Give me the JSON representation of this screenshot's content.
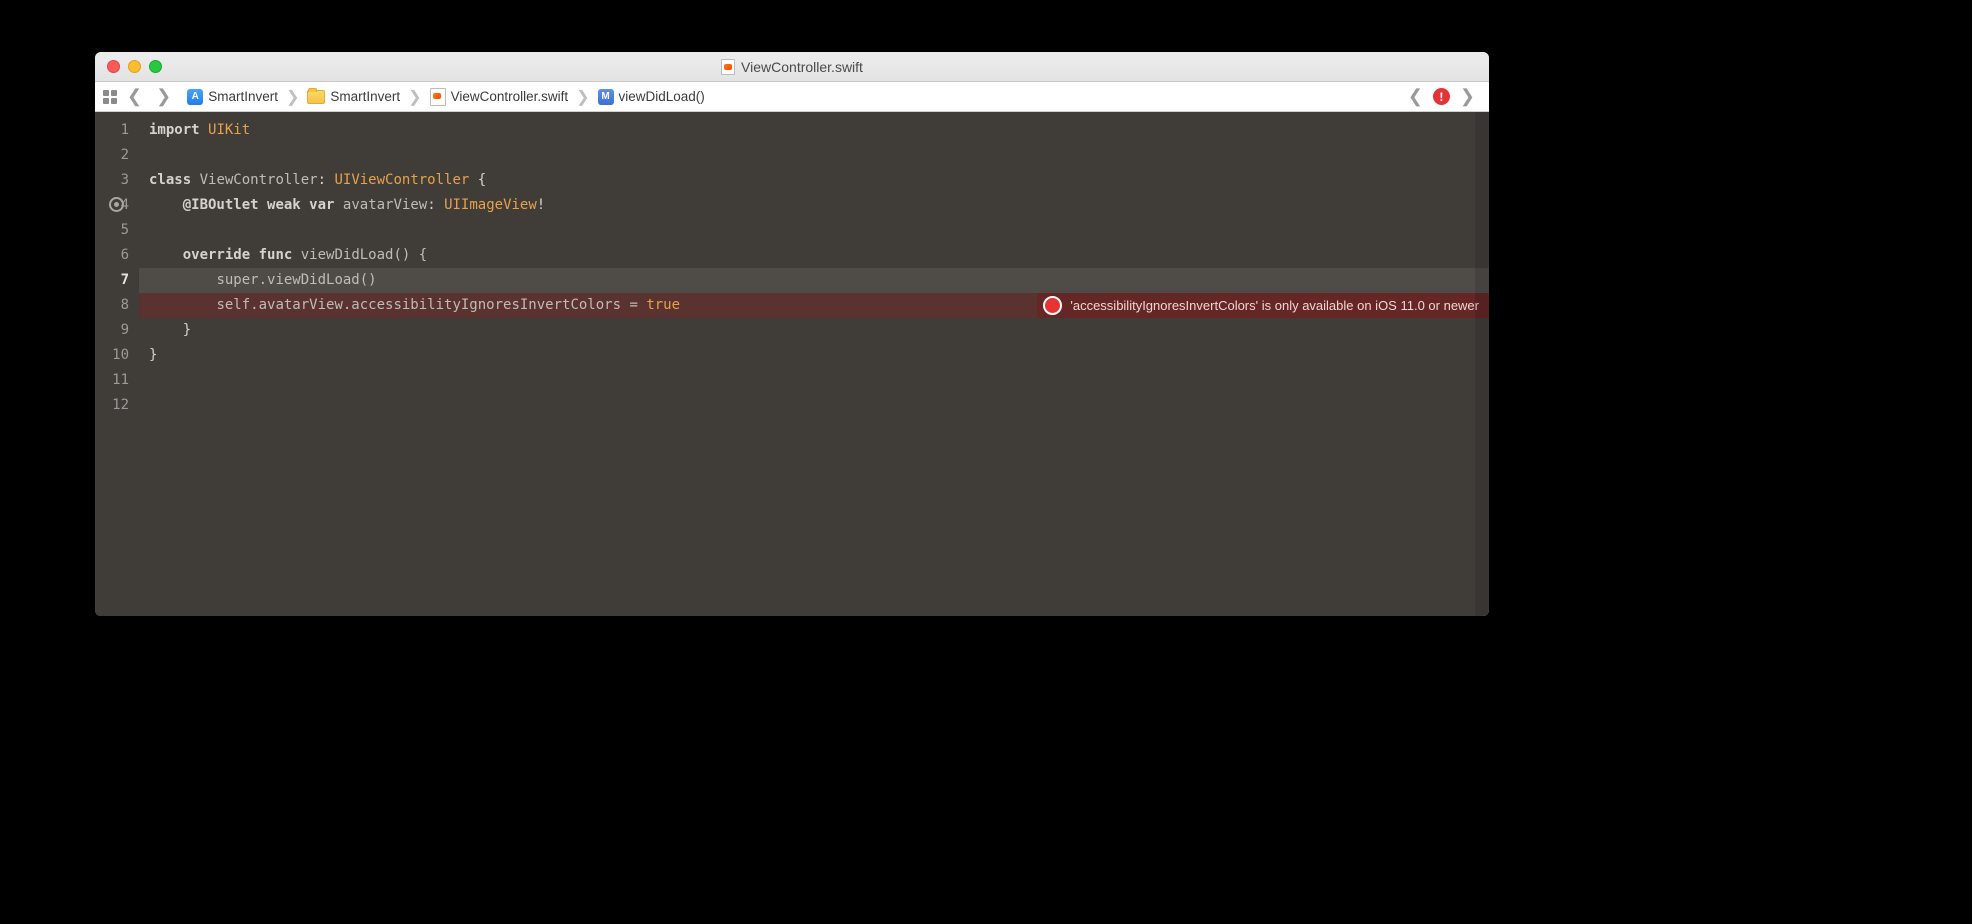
{
  "window": {
    "title": "ViewController.swift"
  },
  "path": {
    "project": "SmartInvert",
    "folder": "SmartInvert",
    "file": "ViewController.swift",
    "method": "viewDidLoad()"
  },
  "error_badge": "!",
  "code": {
    "l1_import": "import",
    "l1_uikit": "UIKit",
    "l3_class": "class",
    "l3_name": "ViewController",
    "l3_colon": ": ",
    "l3_super": "UIViewController",
    "l3_brace": " {",
    "l4_outlet": "@IBOutlet",
    "l4_weak": "weak",
    "l4_var": "var",
    "l4_name": "avatarView",
    "l4_colon": ": ",
    "l4_type": "UIImageView",
    "l4_bang": "!",
    "l6_override": "override",
    "l6_func": "func",
    "l6_sig": "viewDidLoad() {",
    "l7": "super.viewDidLoad()",
    "l8_lhs": "self.avatarView.accessibilityIgnoresInvertColors = ",
    "l8_rhs": "true",
    "l9": "}",
    "l10": "}"
  },
  "error": {
    "message": "'accessibilityIgnoresInvertColors' is only available on iOS 11.0 or newer"
  },
  "lines": [
    "1",
    "2",
    "3",
    "4",
    "5",
    "6",
    "7",
    "8",
    "9",
    "10",
    "11",
    "12"
  ],
  "current_line_index": 6
}
